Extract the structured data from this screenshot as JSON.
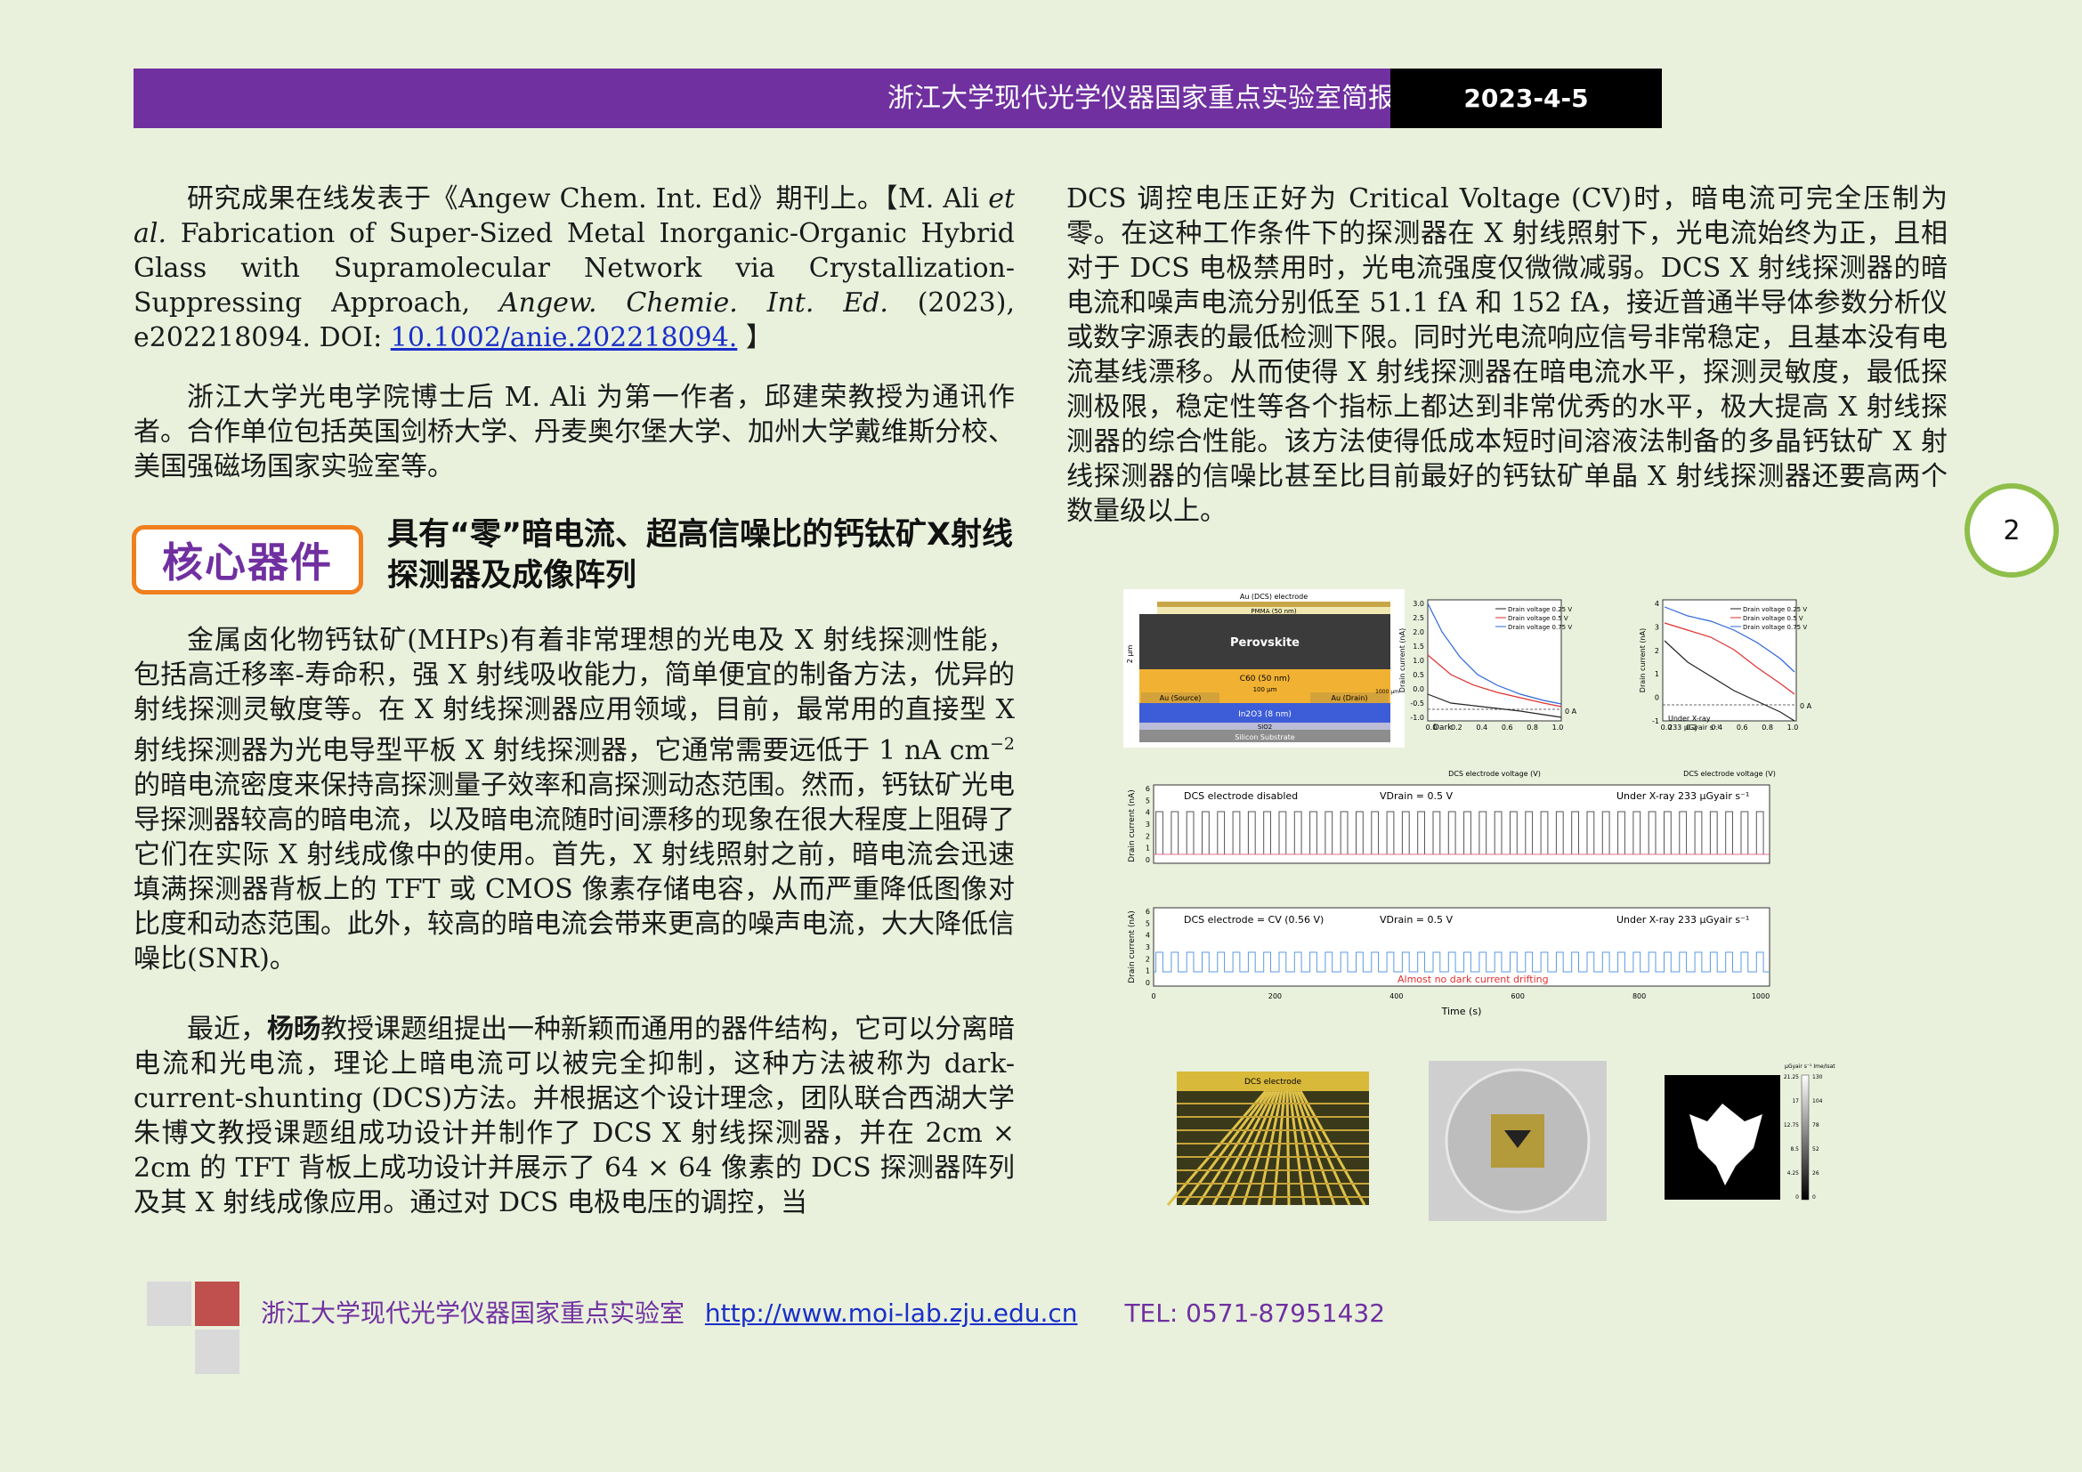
{
  "header": {
    "title": "浙江大学现代光学仪器国家重点实验室简报",
    "date": "2023-4-5"
  },
  "left": {
    "p1_a": "研究成果在线发表于《Angew Chem. Int. Ed》期刊上。【M. Ali ",
    "p1_etal": "et al.",
    "p1_b": " Fabrication of Super-Sized Metal Inorganic-Organic Hybrid Glass with Supramolecular Network via Crystallization-Suppressing Approach, ",
    "p1_journal": "Angew. Chemie. Int. Ed.",
    "p1_c": " (2023), e202218094. DOI: ",
    "p1_doi": "10.1002/anie.202218094.",
    "p1_end": " 】",
    "p2": "浙江大学光电学院博士后 M. Ali 为第一作者，邱建荣教授为通讯作者。合作单位包括英国剑桥大学、丹麦奥尔堡大学、加州大学戴维斯分校、美国强磁场国家实验室等。",
    "badge": "核心器件",
    "section_title": "具有“零”暗电流、超高信噪比的钙钛矿X射线探测器及成像阵列",
    "p3_a": "金属卤化物钙钛矿(MHPs)有着非常理想的光电及 X 射线探测性能，包括高迁移率-寿命积，强 X 射线吸收能力，简单便宜的制备方法，优异的射线探测灵敏度等。在 X 射线探测器应用领域，目前，最常用的直接型 X 射线探测器为光电导型平板 X 射线探测器，它通常需要远低于 1 nA cm",
    "p3_sup": "−2",
    "p3_b": " 的暗电流密度来保持高探测量子效率和高探测动态范围。然而，钙钛矿光电导探测器较高的暗电流，以及暗电流随时间漂移的现象在很大程度上阻碍了它们在实际 X 射线成像中的使用。首先，X 射线照射之前，暗电流会迅速填满探测器背板上的 TFT 或 CMOS 像素存储电容，从而严重降低图像对比度和动态范围。此外，较高的暗电流会带来更高的噪声电流，大大降低信噪比(SNR)。",
    "p4_a": "最近，",
    "p4_name": "杨旸",
    "p4_b": "教授课题组提出一种新颖而通用的器件结构，它可以分离暗电流和光电流，理论上暗电流可以被完全抑制，这种方法被称为 dark-current-shunting (DCS)方法。并根据这个设计理念，团队联合西湖大学朱博文教授课题组成功设计并制作了 DCS X 射线探测器，并在 2cm × 2cm 的 TFT 背板上成功设计并展示了 64 × 64 像素的 DCS 探测器阵列及其 X 射线成像应用。通过对 DCS 电极电压的调控，当"
  },
  "right": {
    "p1": "DCS 调控电压正好为 Critical Voltage (CV)时，暗电流可完全压制为零。在这种工作条件下的探测器在 X 射线照射下，光电流始终为正，且相对于 DCS 电极禁用时，光电流强度仅微微减弱。DCS X 射线探测器的暗电流和噪声电流分别低至 51.1 fA 和 152 fA，接近普通半导体参数分析仪或数字源表的最低检测下限。同时光电流响应信号非常稳定，且基本没有电流基线漂移。从而使得 X 射线探测器在暗电流水平，探测灵敏度，最低探测极限，稳定性等各个指标上都达到非常优秀的水平，极大提高 X 射线探测器的综合性能。该方法使得低成本短时间溶液法制备的多晶钙钛矿 X 射线探测器的信噪比甚至比目前最好的钙钛矿单晶 X 射线探测器还要高两个数量级以上。"
  },
  "page_number": "2",
  "figure": {
    "device": {
      "top_label": "Au (DCS) electrode",
      "pmma": "PMMA (50 nm)",
      "perovskite": "Perovskite",
      "c60": "C60 (50 nm)",
      "gap": "100 μm",
      "width": "1000 μm",
      "source": "Au (Source)",
      "drain": "Au (Drain)",
      "in2o3": "In2O3 (8 nm)",
      "sio2": "SiO2",
      "substrate": "Silicon Substrate",
      "thickness": "2 μm"
    },
    "panel_dark": {
      "legend": [
        "Drain voltage 0.25 V",
        "Drain voltage 0.5 V",
        "Drain voltage 0.75 V"
      ],
      "y_ticks": [
        "3.0",
        "2.5",
        "2.0",
        "1.5",
        "1.0",
        "0.5",
        "0.0",
        "-0.5",
        "-1.0"
      ],
      "x_ticks": [
        "0.0",
        "0.2",
        "0.4",
        "0.6",
        "0.8",
        "1.0"
      ],
      "ylabel": "Drain current (nA)",
      "xlabel": "DCS electrode voltage (V)",
      "note": "Dark",
      "zero": "0 A"
    },
    "panel_xray": {
      "legend": [
        "Drain voltage 0.25 V",
        "Drain voltage 0.5 V",
        "Drain voltage 0.75 V"
      ],
      "y_ticks": [
        "4",
        "3",
        "2",
        "1",
        "0",
        "-1"
      ],
      "x_ticks": [
        "0.0",
        "0.2",
        "0.4",
        "0.6",
        "0.8",
        "1.0"
      ],
      "ylabel": "Drain current (nA)",
      "xlabel": "DCS electrode voltage (V)",
      "note1": "Under X-ray",
      "note2": "233 μGyair s⁻¹",
      "zero": "0 A"
    },
    "time_top": {
      "label": "DCS electrode disabled",
      "vdrain": "VDrain = 0.5 V",
      "xray": "Under X-ray 233 μGyair s⁻¹",
      "ylabel": "Drain current (nA)",
      "y_ticks": [
        "6",
        "5",
        "4",
        "3",
        "2",
        "1",
        "0"
      ]
    },
    "time_bottom": {
      "label": "DCS electrode = CV (0.56 V)",
      "vdrain": "VDrain = 0.5 V",
      "xray": "Under X-ray 233 μGyair s⁻¹",
      "note": "Almost no dark current drifting",
      "ylabel": "Drain current (nA)",
      "y_ticks": [
        "6",
        "5",
        "4",
        "3",
        "2",
        "1",
        "0"
      ],
      "x_ticks": [
        "0",
        "200",
        "400",
        "600",
        "800",
        "1000"
      ],
      "xlabel": "Time (s)"
    },
    "array_label": "DCS electrode",
    "colorbar_unit": "μGyair s⁻¹  Ime/Isat",
    "colorbar_left": [
      "21.25",
      "17",
      "12.75",
      "8.5",
      "4.25",
      "0"
    ],
    "colorbar_right": [
      "130",
      "104",
      "78",
      "52",
      "26",
      "0"
    ]
  },
  "footer": {
    "lab": "浙江大学现代光学仪器国家重点实验室",
    "url": "http://www.moi-lab.zju.edu.cn",
    "tel": "TEL: 0571-87951432"
  },
  "colors": {
    "header": "#7030a0",
    "badge_border": "#f07f1d",
    "circle_border": "#8fbf4a",
    "footer_red": "#c0504d"
  }
}
